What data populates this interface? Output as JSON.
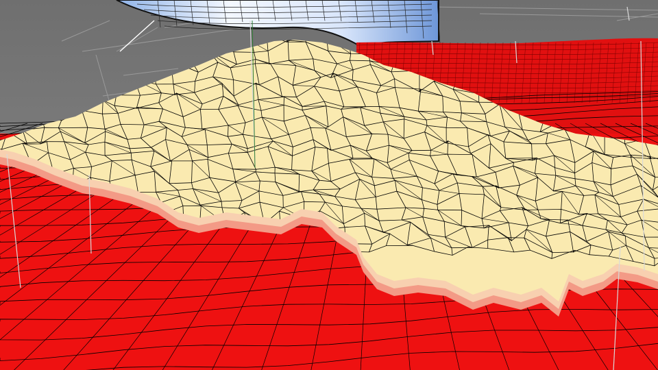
{
  "viewport": {
    "view": "perspective",
    "shading": "wireframe-on-shaded",
    "colors": {
      "background": "#7a7a7a",
      "background_light": "#8c8c8c",
      "terrain_low": "#ee1111",
      "terrain_low_dark": "#d80e0e",
      "terrain_mid": "#f6b39c",
      "terrain_high": "#faeab0",
      "mesh_line": "#000000",
      "guide_line": "#d9d9d9",
      "axis_line": "#2e7d32",
      "sky_dome": "#e6efff",
      "sky_dome_blue": "#5f8fd6"
    }
  }
}
